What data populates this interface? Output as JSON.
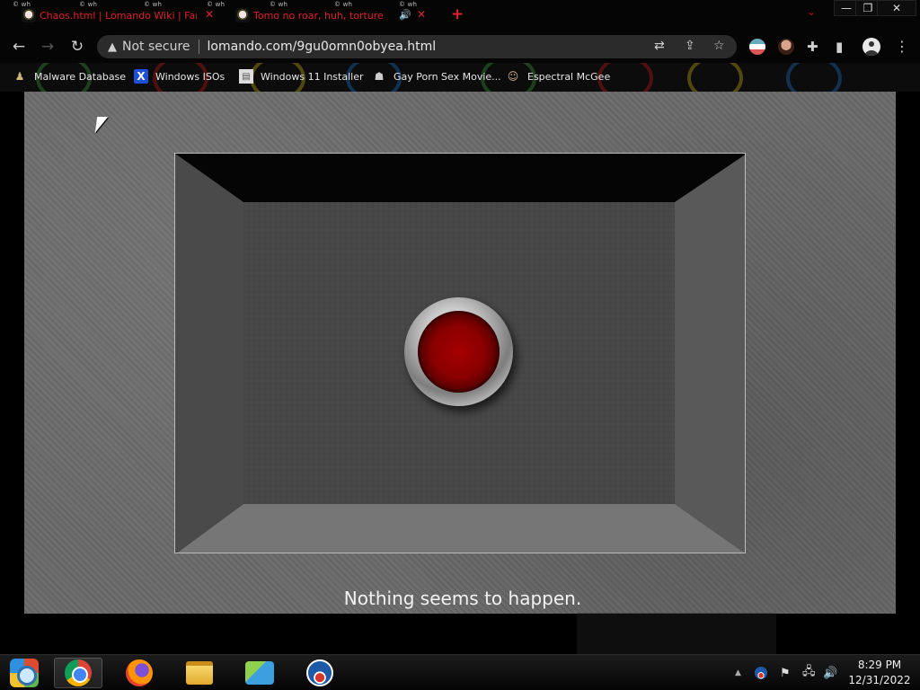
{
  "browser": {
    "tabs": [
      {
        "title": "Chaos.html | Lomando Wiki | Fan",
        "active": false
      },
      {
        "title": "Tomo no roar, huh, torture",
        "active": true,
        "audio": "🔊"
      }
    ],
    "new_tab": "+",
    "url_security": "Not secure",
    "url": "lomando.com/9gu0omn0obyea.html",
    "bookmarks": [
      {
        "label": "Malware Database",
        "icon": "user-icon"
      },
      {
        "label": "Windows ISOs",
        "icon": "x-logo-icon"
      },
      {
        "label": "Windows 11 Installer",
        "icon": "document-icon"
      },
      {
        "label": "Gay Porn Sex Movie...",
        "icon": "ghost-icon"
      },
      {
        "label": "Espectral McGee",
        "icon": "face-icon"
      }
    ],
    "watermark": "© wh"
  },
  "page": {
    "status_message": "Nothing seems to happen."
  },
  "taskbar": {
    "apps": [
      "start-orb",
      "chrome",
      "firefox",
      "file-explorer",
      "network-app",
      "obama-logo"
    ],
    "time": "8:29 PM",
    "date": "12/31/2022"
  },
  "colors": {
    "tab_text": "#e0202a",
    "button_red": "#a50000",
    "stage_gray": "#6a6a6a"
  }
}
